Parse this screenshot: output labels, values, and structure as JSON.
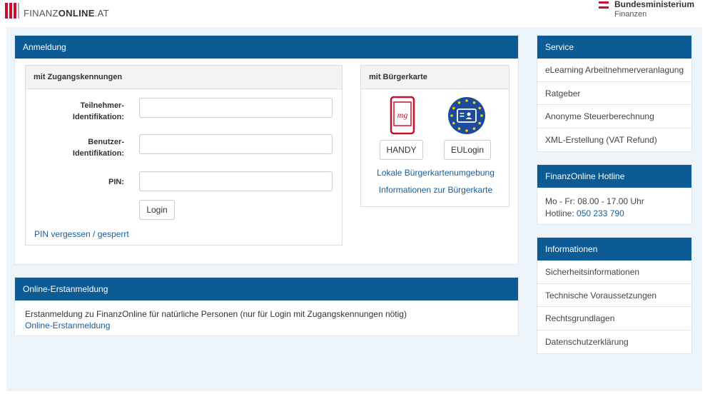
{
  "header": {
    "logo_prefix": "FINANZ",
    "logo_bold": "ONLINE",
    "logo_suffix": ".AT",
    "ministry_title": "Bundesministerium",
    "ministry_sub": "Finanzen"
  },
  "anmeldung": {
    "title": "Anmeldung",
    "zugang": {
      "title": "mit Zugangskennungen",
      "teilnehmer_label_1": "Teilnehmer-",
      "teilnehmer_label_2": "Identifikation:",
      "teilnehmer_value": "",
      "benutzer_label_1": "Benutzer-",
      "benutzer_label_2": "Identifikation:",
      "benutzer_value": "",
      "pin_label": "PIN:",
      "pin_value": "",
      "login_button": "Login",
      "pin_forgot_link": "PIN vergessen / gesperrt"
    },
    "buergerkarte": {
      "title": "mit Bürgerkarte",
      "handy_button": "HANDY",
      "eulogin_button": "EULogin",
      "lokale_link": "Lokale Bürgerkartenumgebung",
      "info_link": "Informationen zur Bürgerkarte",
      "handy_icon_text": "mg"
    }
  },
  "erstanmeldung": {
    "title": "Online-Erstanmeldung",
    "text": "Erstanmeldung zu FinanzOnline für natürliche Personen (nur für Login mit Zugangskennungen nötig)",
    "link": "Online-Erstanmeldung"
  },
  "service": {
    "title": "Service",
    "items": [
      {
        "label": "eLearning Arbeitnehmerveranlagung"
      },
      {
        "label": "Ratgeber"
      },
      {
        "label": "Anonyme Steuerberechnung"
      },
      {
        "label": "XML-Erstellung (VAT Refund)"
      }
    ]
  },
  "hotline": {
    "title": "FinanzOnline Hotline",
    "hours": "Mo - Fr: 08.00 - 17.00 Uhr",
    "phone_label": "Hotline:",
    "phone_number": "050 233 790"
  },
  "informationen": {
    "title": "Informationen",
    "items": [
      {
        "label": "Sicherheitsinformationen"
      },
      {
        "label": "Technische Voraussetzungen"
      },
      {
        "label": "Rechtsgrundlagen"
      },
      {
        "label": "Datenschutzerklärung"
      }
    ]
  },
  "colors": {
    "primary_blue": "#0c5b94",
    "link_blue": "#1a5d96",
    "brand_red": "#c8102e",
    "background_blue": "#edf4fa"
  }
}
